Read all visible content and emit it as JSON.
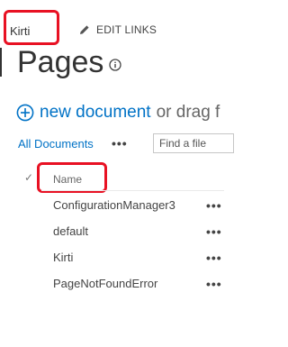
{
  "header": {
    "site_link": "Kirti",
    "edit_links_label": "EDIT LINKS"
  },
  "page": {
    "title": "Pages"
  },
  "toolbar": {
    "new_document_label": "new document",
    "drag_text": "or drag f"
  },
  "view": {
    "all_documents_label": "All Documents",
    "more_label": "•••",
    "search_placeholder": "Find a file"
  },
  "table": {
    "column_name": "Name",
    "rows": [
      {
        "name": "ConfigurationManager3",
        "menu": "•••"
      },
      {
        "name": "default",
        "menu": "•••"
      },
      {
        "name": "Kirti",
        "menu": "•••"
      },
      {
        "name": "PageNotFoundError",
        "menu": "•••"
      }
    ]
  },
  "colors": {
    "accent": "#0072c6",
    "highlight": "#e81123"
  },
  "icons": {
    "edit": "pencil-icon",
    "info": "info-icon",
    "new": "plus-circle-icon",
    "select_all": "checkmark-icon"
  }
}
